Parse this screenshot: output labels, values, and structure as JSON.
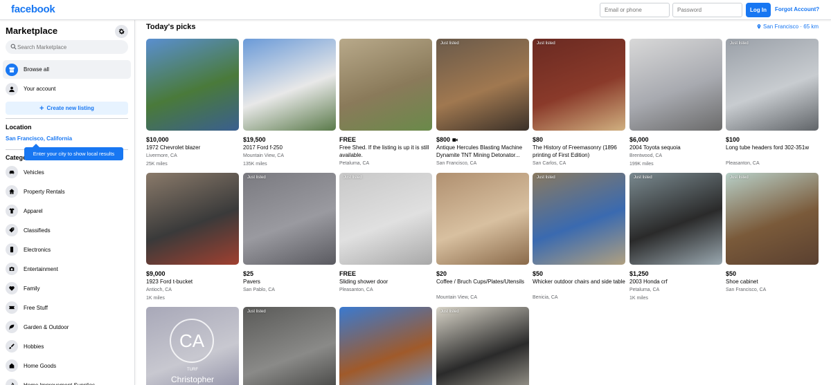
{
  "header": {
    "logo": "facebook",
    "email_placeholder": "Email or phone",
    "password_placeholder": "Password",
    "login_label": "Log In",
    "forgot_label": "Forgot Account?"
  },
  "sidebar": {
    "title": "Marketplace",
    "search_placeholder": "Search Marketplace",
    "nav": [
      {
        "label": "Browse all",
        "icon": "storefront-icon"
      },
      {
        "label": "Your account",
        "icon": "person-icon"
      }
    ],
    "create_label": "Create new listing",
    "location_heading": "Location",
    "location_city": "San Francisco, California",
    "tooltip": "Enter your city to show local results",
    "categories_heading": "Categories",
    "categories": [
      {
        "label": "Vehicles",
        "icon": "car-icon"
      },
      {
        "label": "Property Rentals",
        "icon": "house-icon"
      },
      {
        "label": "Apparel",
        "icon": "shirt-icon"
      },
      {
        "label": "Classifieds",
        "icon": "tag-icon"
      },
      {
        "label": "Electronics",
        "icon": "phone-icon"
      },
      {
        "label": "Entertainment",
        "icon": "camera-icon"
      },
      {
        "label": "Family",
        "icon": "heart-icon"
      },
      {
        "label": "Free Stuff",
        "icon": "ticket-icon"
      },
      {
        "label": "Garden & Outdoor",
        "icon": "leaf-icon"
      },
      {
        "label": "Hobbies",
        "icon": "brush-icon"
      },
      {
        "label": "Home Goods",
        "icon": "home-icon"
      },
      {
        "label": "Home Improvement Supplies",
        "icon": "tools-icon"
      }
    ]
  },
  "main": {
    "title": "Today's picks",
    "location": "San Francisco · 65 km",
    "listings": [
      {
        "price": "$10,000",
        "title": "1972 Chevrolet blazer",
        "place": "Livermore, CA",
        "miles": "25K miles",
        "badge": "",
        "video": false,
        "colors": [
          "#5a8fd0",
          "#4a7a3a",
          "#3a5f8f"
        ]
      },
      {
        "price": "$19,500",
        "title": "2017 Ford f-250",
        "place": "Mountain View, CA",
        "miles": "135K miles",
        "badge": "",
        "video": false,
        "colors": [
          "#6a9ad8",
          "#e8e8e8",
          "#5a7a4a"
        ]
      },
      {
        "price": "FREE",
        "title": "Free Shed. If the listing is up it is still available.",
        "place": "Petaluma, CA",
        "miles": "",
        "badge": "",
        "video": false,
        "colors": [
          "#b8a98a",
          "#8a7a5a",
          "#6a8a4a"
        ]
      },
      {
        "price": "$800",
        "title": "Antique Hercules Blasting Machine Dynamite TNT Mining Detonator...",
        "place": "San Francisco, CA",
        "miles": "",
        "badge": "Just listed",
        "video": true,
        "colors": [
          "#6a5a4a",
          "#a07850",
          "#3a3028"
        ]
      },
      {
        "price": "$80",
        "title": "The History of Freemasonry (1896 printing of First Edition)",
        "place": "San Carlos, CA",
        "miles": "",
        "badge": "Just listed",
        "video": false,
        "colors": [
          "#6a2a22",
          "#8a3a2a",
          "#d0b080"
        ]
      },
      {
        "price": "$6,000",
        "title": "2004 Toyota sequoia",
        "place": "Brentwood, CA",
        "miles": "199K miles",
        "badge": "",
        "video": false,
        "colors": [
          "#d8d8d8",
          "#a8aab0",
          "#6a6a6a"
        ]
      },
      {
        "price": "$100",
        "title": "Long tube headers ford 302-351w",
        "place": "Pleasanton, CA",
        "miles": "",
        "badge": "Just listed",
        "video": false,
        "colors": [
          "#9aa0a8",
          "#c8ccd0",
          "#606468"
        ]
      },
      {
        "price": "$9,000",
        "title": "1923 Ford t-bucket",
        "place": "Antioch, CA",
        "miles": "1K miles",
        "badge": "",
        "video": false,
        "colors": [
          "#8a7a6a",
          "#3a3a3a",
          "#a04030"
        ]
      },
      {
        "price": "$25",
        "title": "Pavers",
        "place": "San Pablo, CA",
        "miles": "",
        "badge": "Just listed",
        "video": false,
        "colors": [
          "#7a7a80",
          "#9a9aa0",
          "#5a5a60"
        ]
      },
      {
        "price": "FREE",
        "title": "Sliding shower door",
        "place": "Pleasanton, CA",
        "miles": "",
        "badge": "Just listed",
        "video": false,
        "colors": [
          "#c8c8c8",
          "#e0e0e0",
          "#a8a8a8"
        ]
      },
      {
        "price": "$20",
        "title": "Coffee / Bruch Cups/Plates/Utensils",
        "place": "Mountain View, CA",
        "miles": "",
        "badge": "",
        "video": false,
        "colors": [
          "#b09070",
          "#d8c0a0",
          "#8a6a4a"
        ]
      },
      {
        "price": "$50",
        "title": "Whicker outdoor chairs and side table",
        "place": "Benicia, CA",
        "miles": "",
        "badge": "Just listed",
        "video": false,
        "colors": [
          "#8a7a60",
          "#3a6ab0",
          "#b0a080"
        ]
      },
      {
        "price": "$1,250",
        "title": "2003 Honda crf",
        "place": "Petaluma, CA",
        "miles": "1K miles",
        "badge": "Just listed",
        "video": false,
        "colors": [
          "#7a8a90",
          "#2a2a2a",
          "#9aa8b0"
        ]
      },
      {
        "price": "$50",
        "title": "Shoe cabinet",
        "place": "San Francisco, CA",
        "miles": "",
        "badge": "Just listed",
        "video": false,
        "colors": [
          "#b8d0c8",
          "#7a5a3a",
          "#5a4030"
        ]
      },
      {
        "price": "",
        "title": "",
        "place": "",
        "miles": "",
        "badge": "",
        "video": false,
        "colors": [
          "#a8a8b8",
          "#c8c8d0",
          "#8888a0"
        ],
        "avatar_initials": "CA",
        "avatar_sub": "TURF",
        "avatar_name": "Christopher"
      },
      {
        "price": "",
        "title": "",
        "place": "",
        "miles": "",
        "badge": "Just listed",
        "video": false,
        "colors": [
          "#5a5a58",
          "#8a8a88",
          "#3a3a38"
        ]
      },
      {
        "price": "",
        "title": "",
        "place": "",
        "miles": "",
        "badge": "",
        "video": false,
        "colors": [
          "#3a7ad0",
          "#a05a2a",
          "#6aa0e0"
        ]
      },
      {
        "price": "",
        "title": "",
        "place": "",
        "miles": "",
        "badge": "Just listed",
        "video": false,
        "colors": [
          "#d8d4c8",
          "#2a2a2a",
          "#b0aca0"
        ]
      }
    ]
  }
}
